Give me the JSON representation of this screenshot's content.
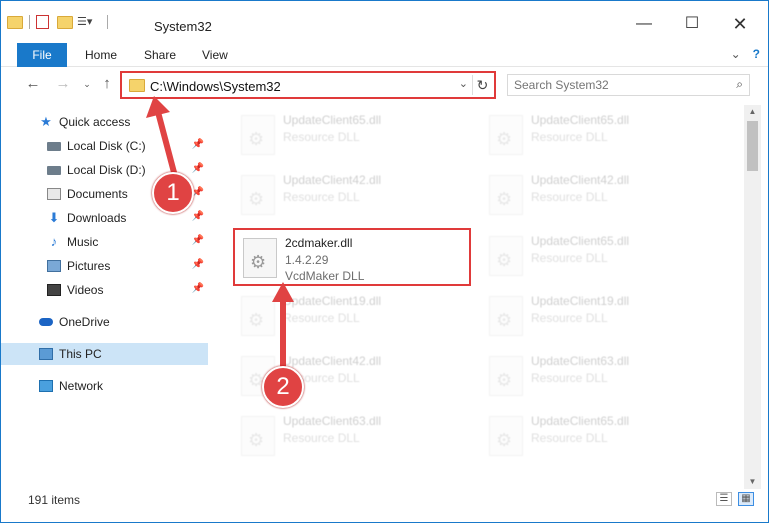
{
  "window": {
    "title": "System32"
  },
  "ribbon": {
    "file": "File",
    "home": "Home",
    "share": "Share",
    "view": "View"
  },
  "address": {
    "path": "C:\\Windows\\System32"
  },
  "search": {
    "placeholder": "Search System32"
  },
  "sidebar": {
    "items": [
      {
        "label": "Quick access"
      },
      {
        "label": "Local Disk (C:)"
      },
      {
        "label": "Local Disk (D:)"
      },
      {
        "label": "Documents"
      },
      {
        "label": "Downloads"
      },
      {
        "label": "Music"
      },
      {
        "label": "Pictures"
      },
      {
        "label": "Videos"
      },
      {
        "label": "OneDrive"
      },
      {
        "label": "This PC"
      },
      {
        "label": "Network"
      }
    ]
  },
  "files": [
    {
      "name": "UpdateClient65.dll",
      "desc": "Resource DLL"
    },
    {
      "name": "UpdateClient65.dll",
      "desc": "Resource DLL"
    },
    {
      "name": "UpdateClient42.dll",
      "desc": "Resource DLL"
    },
    {
      "name": "UpdateClient42.dll",
      "desc": "Resource DLL"
    },
    {
      "name": "2cdmaker.dll",
      "version": "1.4.2.29",
      "desc": "VcdMaker DLL"
    },
    {
      "name": "UpdateClient65.dll",
      "desc": "Resource DLL"
    },
    {
      "name": "UpdateClient19.dll",
      "desc": "Resource DLL"
    },
    {
      "name": "UpdateClient19.dll",
      "desc": "Resource DLL"
    },
    {
      "name": "UpdateClient42.dll",
      "desc": "Resource DLL"
    },
    {
      "name": "UpdateClient63.dll",
      "desc": "Resource DLL"
    },
    {
      "name": "UpdateClient63.dll",
      "desc": "Resource DLL"
    },
    {
      "name": "UpdateClient65.dll",
      "desc": "Resource DLL"
    }
  ],
  "status": {
    "count": "191 items"
  },
  "annotations": {
    "step1": "1",
    "step2": "2"
  },
  "colors": {
    "accent": "#1979ca",
    "highlight": "#e03a3a",
    "selected": "#cce4f7"
  }
}
